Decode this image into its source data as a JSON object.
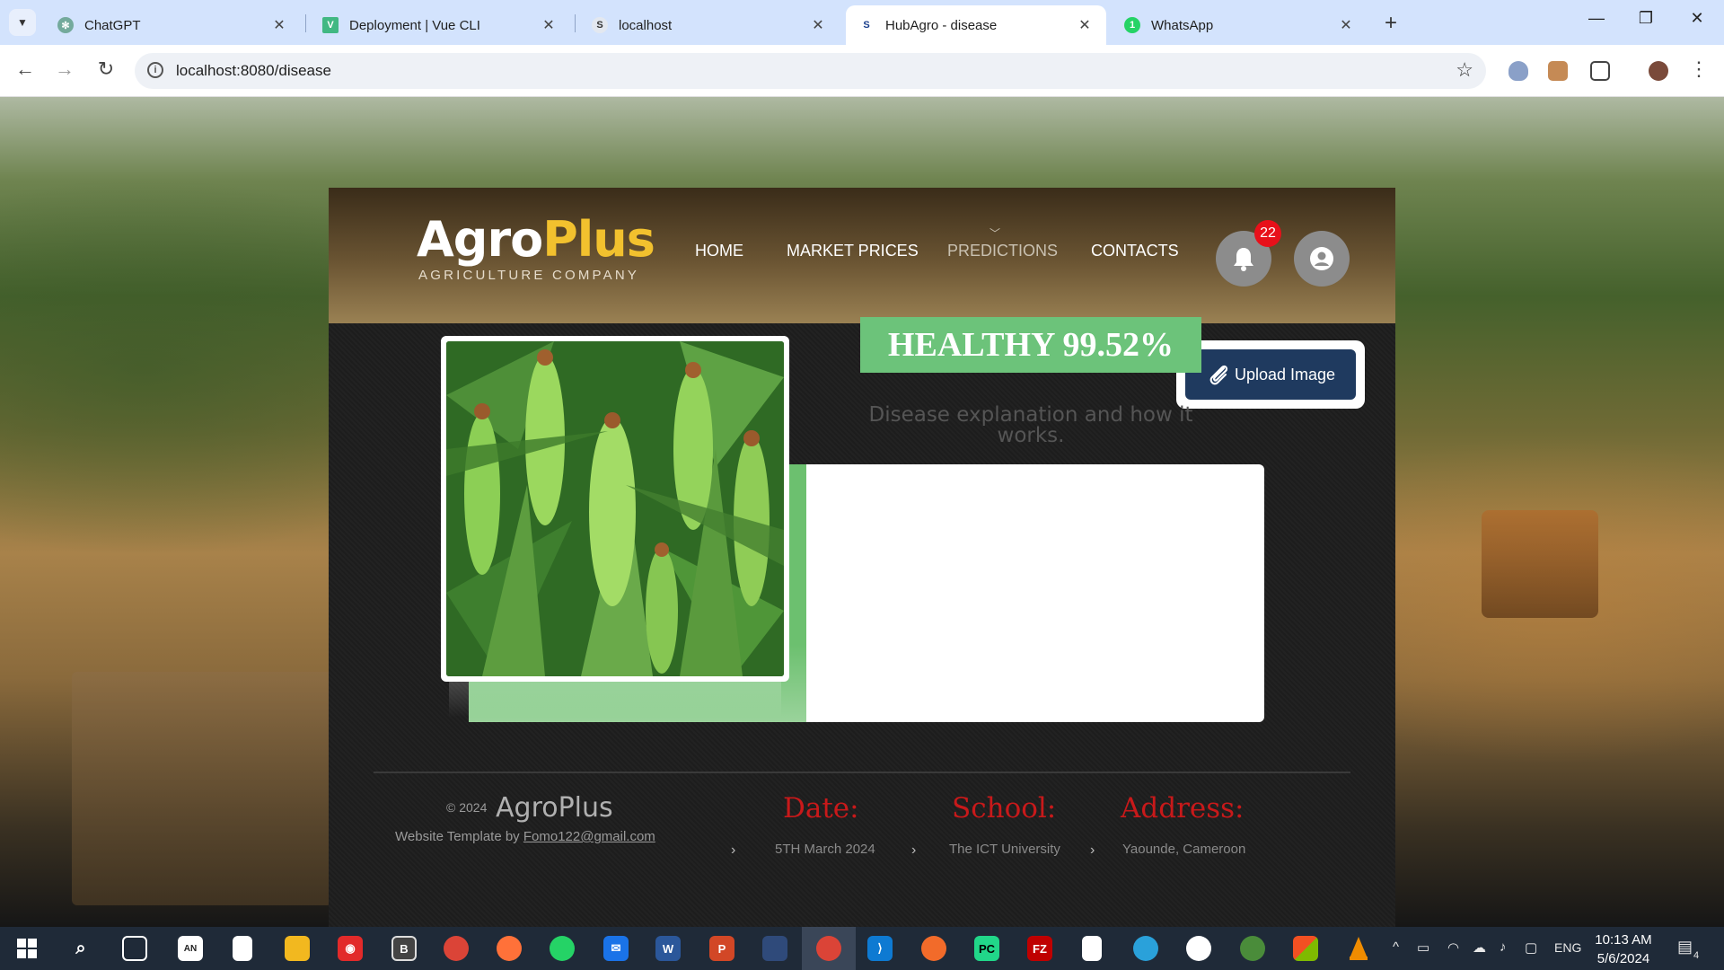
{
  "browser": {
    "tabs": [
      {
        "label": "ChatGPT",
        "icon": "chatgpt-icon",
        "active": false
      },
      {
        "label": "Deployment | Vue CLI",
        "icon": "vue-icon",
        "active": false
      },
      {
        "label": "localhost",
        "icon": "s-icon",
        "active": false
      },
      {
        "label": "HubAgro - disease",
        "icon": "s-icon",
        "active": true
      },
      {
        "label": "WhatsApp",
        "icon": "whatsapp-icon",
        "active": false
      }
    ],
    "url": "localhost:8080/disease",
    "notification_badge": "1"
  },
  "site": {
    "logo": {
      "part1": "Agro",
      "part2": "Plus",
      "tagline": "AGRICULTURE COMPANY"
    },
    "nav": [
      {
        "label": "HOME",
        "active": false
      },
      {
        "label": "MARKET PRICES",
        "active": false
      },
      {
        "label": "PREDICTIONS",
        "active": true
      },
      {
        "label": "CONTACTS",
        "active": false
      }
    ],
    "notification_count": "22",
    "upload_label": "Upload Image",
    "result": {
      "status": "HEALTHY 99.52%",
      "description": "Disease explanation and how it works."
    },
    "footer": {
      "copyright": "© 2024",
      "brand": "AgroPlus",
      "credit_prefix": "Website Template by",
      "credit_email": "Fomo122@gmail.com",
      "date_label": "Date:",
      "date_value": "5TH March 2024",
      "school_label": "School:",
      "school_value": "The ICT University",
      "address_label": "Address:",
      "address_value": "Yaounde, Cameroon"
    }
  },
  "taskbar": {
    "language": "ENG",
    "time": "10:13 AM",
    "date": "5/6/2024",
    "notifications": "4"
  },
  "colors": {
    "accent_green": "#6cc37a",
    "upload_blue": "#1f3a5f",
    "footer_red": "#c8191a",
    "logo_yellow": "#f2c12e"
  }
}
